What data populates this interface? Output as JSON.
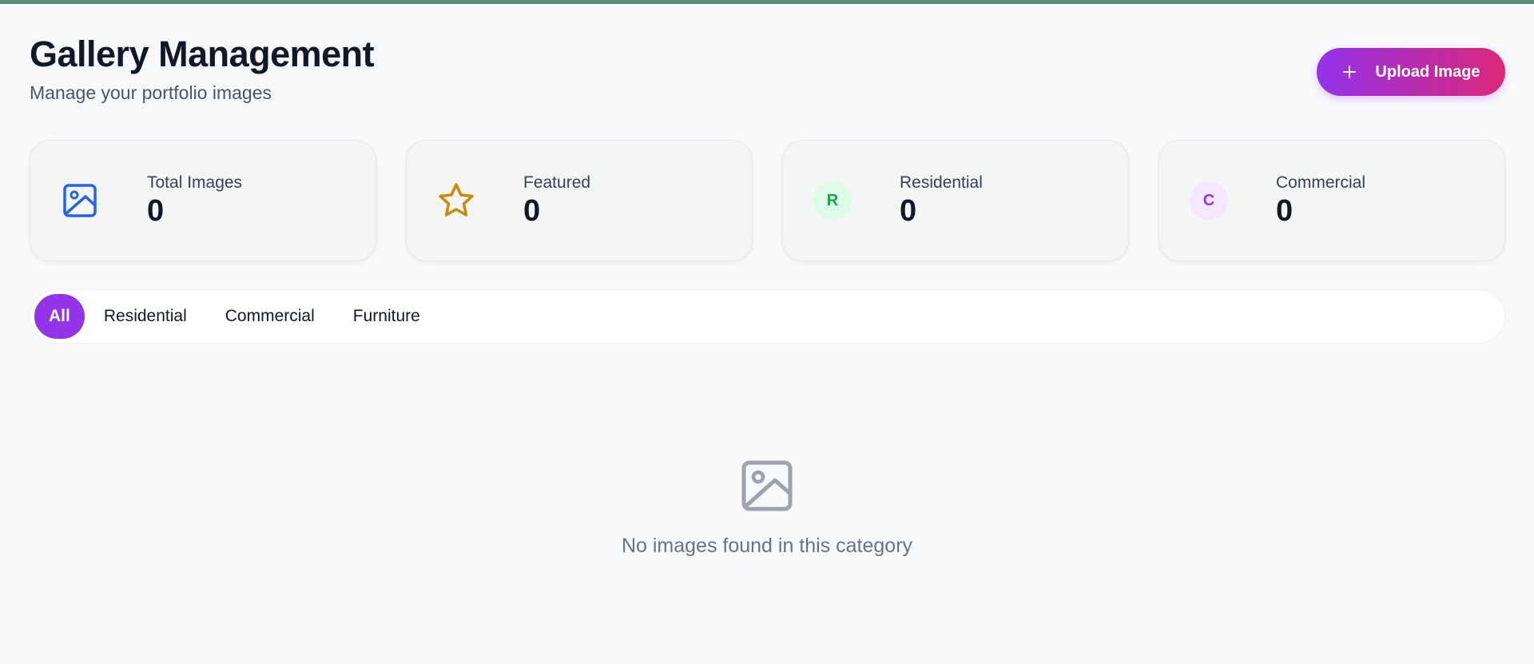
{
  "header": {
    "title": "Gallery Management",
    "subtitle": "Manage your portfolio images",
    "upload_label": "Upload Image"
  },
  "stats": [
    {
      "label": "Total Images",
      "value": "0",
      "icon": "image-icon",
      "color": "#2563eb"
    },
    {
      "label": "Featured",
      "value": "0",
      "icon": "star-icon",
      "color": "#ca8a04"
    },
    {
      "label": "Residential",
      "value": "0",
      "icon": "letter-badge",
      "badge": "R",
      "color": "#16a34a",
      "bg": "#dcfce7"
    },
    {
      "label": "Commercial",
      "value": "0",
      "icon": "letter-badge",
      "badge": "C",
      "color": "#9333ea",
      "bg": "#f3e8ff"
    }
  ],
  "filters": {
    "tabs": [
      "All",
      "Residential",
      "Commercial",
      "Furniture"
    ],
    "active": "All"
  },
  "empty_state": {
    "message": "No images found in this category",
    "icon": "image-icon"
  },
  "colors": {
    "accent": "#9333ea",
    "accent_gradient_end": "#db2777",
    "top_bar": "#5e8a78"
  }
}
